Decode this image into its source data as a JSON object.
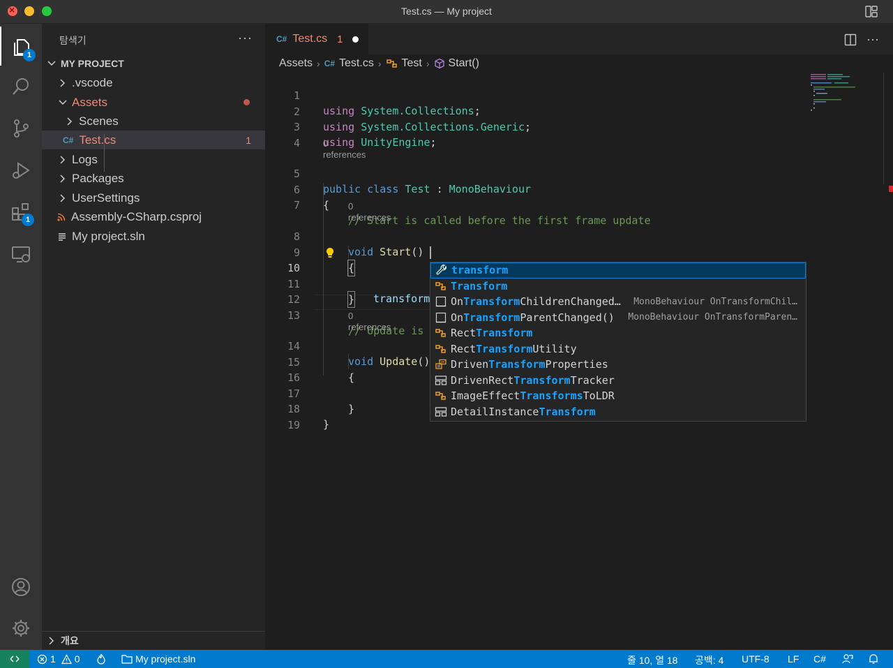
{
  "window": {
    "title": "Test.cs — My project"
  },
  "activity": {
    "explorer_badge": "1",
    "extensions_badge": "1"
  },
  "sidebar": {
    "header": "탐색기",
    "more": "···",
    "project": "MY PROJECT",
    "items": [
      {
        "label": ".vscode"
      },
      {
        "label": "Assets"
      },
      {
        "label": "Scenes"
      },
      {
        "label": "Test.cs",
        "badge": "1"
      },
      {
        "label": "Logs"
      },
      {
        "label": "Packages"
      },
      {
        "label": "UserSettings"
      },
      {
        "label": "Assembly-CSharp.csproj"
      },
      {
        "label": "My project.sln"
      }
    ],
    "outline": "개요"
  },
  "tab": {
    "label": "Test.cs",
    "count": "1",
    "icon": "C#"
  },
  "breadcrumb": {
    "b0": "Assets",
    "b1": "Test.cs",
    "b2": "Test",
    "b3": "Start()"
  },
  "code": {
    "lines": [
      "1",
      "2",
      "3",
      "4",
      "5",
      "6",
      "7",
      "8",
      "9",
      "10",
      "11",
      "12",
      "13",
      "14",
      "15",
      "16",
      "17",
      "18",
      "19"
    ],
    "lens": "0 references",
    "l1_kw": "using",
    "l1_ns": "System.Collections",
    "l1_end": ";",
    "l2_kw": "using",
    "l2_ns": "System.Collections.Generic",
    "l2_end": ";",
    "l3_kw": "using",
    "l3_ns": "UnityEngine",
    "l3_end": ";",
    "l5_a": "public",
    "l5_b": "class",
    "l5_c": "Test",
    "l5_d": ":",
    "l5_e": "MonoBehaviour",
    "l6": "{",
    "l7": "// Start is called before the first frame update",
    "l8_a": "void",
    "l8_b": "Start",
    "l8_c": "()",
    "l9": "{",
    "l10": "transform",
    "l11": "}",
    "l13": "// Update is",
    "l14_a": "void",
    "l14_b": "Update",
    "l14_c": "()",
    "l15": "{",
    "l17": "}",
    "l18": "}"
  },
  "suggest": [
    {
      "pre": "",
      "hl": "transform",
      "post": "",
      "detail": "",
      "icon": "wrench-icon"
    },
    {
      "pre": "",
      "hl": "Transform",
      "post": "",
      "detail": "",
      "icon": "class-icon"
    },
    {
      "pre": "On",
      "hl": "Transform",
      "post": "ChildrenChanged…",
      "detail": "MonoBehaviour OnTransformChil…",
      "icon": "method-icon"
    },
    {
      "pre": "On",
      "hl": "Transform",
      "post": "ParentChanged()",
      "detail": "MonoBehaviour OnTransformParen…",
      "icon": "method-icon"
    },
    {
      "pre": "Rect",
      "hl": "Transform",
      "post": "",
      "detail": "",
      "icon": "class-icon"
    },
    {
      "pre": "Rect",
      "hl": "Transform",
      "post": "Utility",
      "detail": "",
      "icon": "class-icon"
    },
    {
      "pre": "Driven",
      "hl": "Transform",
      "post": "Properties",
      "detail": "",
      "icon": "enum-icon"
    },
    {
      "pre": "DrivenRect",
      "hl": "Transform",
      "post": "Tracker",
      "detail": "",
      "icon": "struct-icon"
    },
    {
      "pre": "ImageEffect",
      "hl": "Transforms",
      "post": "ToLDR",
      "detail": "",
      "icon": "class-icon"
    },
    {
      "pre": "DetailInstance",
      "hl": "Transform",
      "post": "",
      "detail": "",
      "icon": "struct-icon"
    }
  ],
  "status": {
    "errors": "1",
    "warnings": "0",
    "solution": "My project.sln",
    "position": "줄 10, 열 18",
    "spaces": "공백: 4",
    "encoding": "UTF-8",
    "eol": "LF",
    "language": "C#"
  }
}
